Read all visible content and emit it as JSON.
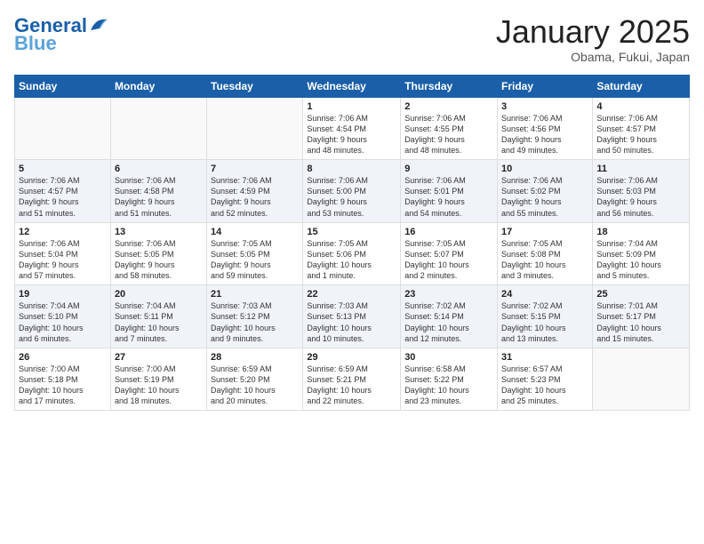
{
  "logo": {
    "line1": "General",
    "line2": "Blue"
  },
  "title": "January 2025",
  "subtitle": "Obama, Fukui, Japan",
  "weekdays": [
    "Sunday",
    "Monday",
    "Tuesday",
    "Wednesday",
    "Thursday",
    "Friday",
    "Saturday"
  ],
  "weeks": [
    [
      {
        "day": "",
        "info": ""
      },
      {
        "day": "",
        "info": ""
      },
      {
        "day": "",
        "info": ""
      },
      {
        "day": "1",
        "info": "Sunrise: 7:06 AM\nSunset: 4:54 PM\nDaylight: 9 hours\nand 48 minutes."
      },
      {
        "day": "2",
        "info": "Sunrise: 7:06 AM\nSunset: 4:55 PM\nDaylight: 9 hours\nand 48 minutes."
      },
      {
        "day": "3",
        "info": "Sunrise: 7:06 AM\nSunset: 4:56 PM\nDaylight: 9 hours\nand 49 minutes."
      },
      {
        "day": "4",
        "info": "Sunrise: 7:06 AM\nSunset: 4:57 PM\nDaylight: 9 hours\nand 50 minutes."
      }
    ],
    [
      {
        "day": "5",
        "info": "Sunrise: 7:06 AM\nSunset: 4:57 PM\nDaylight: 9 hours\nand 51 minutes."
      },
      {
        "day": "6",
        "info": "Sunrise: 7:06 AM\nSunset: 4:58 PM\nDaylight: 9 hours\nand 51 minutes."
      },
      {
        "day": "7",
        "info": "Sunrise: 7:06 AM\nSunset: 4:59 PM\nDaylight: 9 hours\nand 52 minutes."
      },
      {
        "day": "8",
        "info": "Sunrise: 7:06 AM\nSunset: 5:00 PM\nDaylight: 9 hours\nand 53 minutes."
      },
      {
        "day": "9",
        "info": "Sunrise: 7:06 AM\nSunset: 5:01 PM\nDaylight: 9 hours\nand 54 minutes."
      },
      {
        "day": "10",
        "info": "Sunrise: 7:06 AM\nSunset: 5:02 PM\nDaylight: 9 hours\nand 55 minutes."
      },
      {
        "day": "11",
        "info": "Sunrise: 7:06 AM\nSunset: 5:03 PM\nDaylight: 9 hours\nand 56 minutes."
      }
    ],
    [
      {
        "day": "12",
        "info": "Sunrise: 7:06 AM\nSunset: 5:04 PM\nDaylight: 9 hours\nand 57 minutes."
      },
      {
        "day": "13",
        "info": "Sunrise: 7:06 AM\nSunset: 5:05 PM\nDaylight: 9 hours\nand 58 minutes."
      },
      {
        "day": "14",
        "info": "Sunrise: 7:05 AM\nSunset: 5:05 PM\nDaylight: 9 hours\nand 59 minutes."
      },
      {
        "day": "15",
        "info": "Sunrise: 7:05 AM\nSunset: 5:06 PM\nDaylight: 10 hours\nand 1 minute."
      },
      {
        "day": "16",
        "info": "Sunrise: 7:05 AM\nSunset: 5:07 PM\nDaylight: 10 hours\nand 2 minutes."
      },
      {
        "day": "17",
        "info": "Sunrise: 7:05 AM\nSunset: 5:08 PM\nDaylight: 10 hours\nand 3 minutes."
      },
      {
        "day": "18",
        "info": "Sunrise: 7:04 AM\nSunset: 5:09 PM\nDaylight: 10 hours\nand 5 minutes."
      }
    ],
    [
      {
        "day": "19",
        "info": "Sunrise: 7:04 AM\nSunset: 5:10 PM\nDaylight: 10 hours\nand 6 minutes."
      },
      {
        "day": "20",
        "info": "Sunrise: 7:04 AM\nSunset: 5:11 PM\nDaylight: 10 hours\nand 7 minutes."
      },
      {
        "day": "21",
        "info": "Sunrise: 7:03 AM\nSunset: 5:12 PM\nDaylight: 10 hours\nand 9 minutes."
      },
      {
        "day": "22",
        "info": "Sunrise: 7:03 AM\nSunset: 5:13 PM\nDaylight: 10 hours\nand 10 minutes."
      },
      {
        "day": "23",
        "info": "Sunrise: 7:02 AM\nSunset: 5:14 PM\nDaylight: 10 hours\nand 12 minutes."
      },
      {
        "day": "24",
        "info": "Sunrise: 7:02 AM\nSunset: 5:15 PM\nDaylight: 10 hours\nand 13 minutes."
      },
      {
        "day": "25",
        "info": "Sunrise: 7:01 AM\nSunset: 5:17 PM\nDaylight: 10 hours\nand 15 minutes."
      }
    ],
    [
      {
        "day": "26",
        "info": "Sunrise: 7:00 AM\nSunset: 5:18 PM\nDaylight: 10 hours\nand 17 minutes."
      },
      {
        "day": "27",
        "info": "Sunrise: 7:00 AM\nSunset: 5:19 PM\nDaylight: 10 hours\nand 18 minutes."
      },
      {
        "day": "28",
        "info": "Sunrise: 6:59 AM\nSunset: 5:20 PM\nDaylight: 10 hours\nand 20 minutes."
      },
      {
        "day": "29",
        "info": "Sunrise: 6:59 AM\nSunset: 5:21 PM\nDaylight: 10 hours\nand 22 minutes."
      },
      {
        "day": "30",
        "info": "Sunrise: 6:58 AM\nSunset: 5:22 PM\nDaylight: 10 hours\nand 23 minutes."
      },
      {
        "day": "31",
        "info": "Sunrise: 6:57 AM\nSunset: 5:23 PM\nDaylight: 10 hours\nand 25 minutes."
      },
      {
        "day": "",
        "info": ""
      }
    ]
  ]
}
